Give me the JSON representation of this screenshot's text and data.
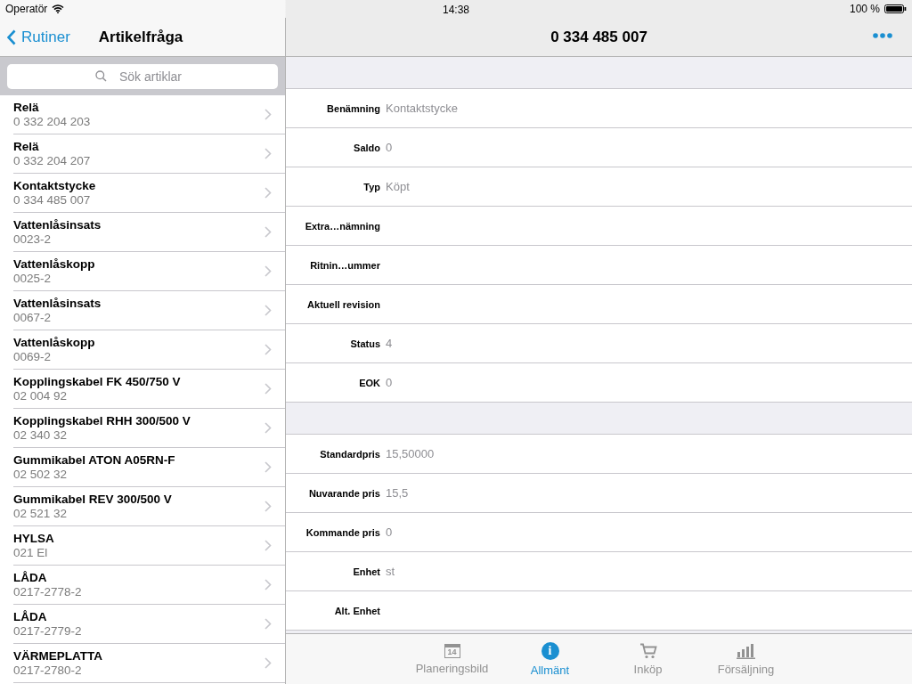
{
  "status_bar": {
    "carrier": "Operatör",
    "time": "14:38",
    "battery": "100 %"
  },
  "master": {
    "back": "Rutiner",
    "title": "Artikelfråga",
    "search": {
      "placeholder": "Sök artiklar"
    },
    "items": [
      {
        "name": "Relä",
        "number": "0 332 204 203"
      },
      {
        "name": "Relä",
        "number": "0 332 204 207"
      },
      {
        "name": "Kontaktstycke",
        "number": "0 334 485 007"
      },
      {
        "name": "Vattenlåsinsats",
        "number": "0023-2"
      },
      {
        "name": "Vattenlåskopp",
        "number": "0025-2"
      },
      {
        "name": "Vattenlåsinsats",
        "number": "0067-2"
      },
      {
        "name": "Vattenlåskopp",
        "number": "0069-2"
      },
      {
        "name": "Kopplingskabel FK 450/750 V",
        "number": "02 004 92"
      },
      {
        "name": "Kopplingskabel RHH 300/500 V",
        "number": "02 340 32"
      },
      {
        "name": "Gummikabel ATON A05RN-F",
        "number": "02 502 32"
      },
      {
        "name": "Gummikabel REV 300/500 V",
        "number": "02 521 32"
      },
      {
        "name": "HYLSA",
        "number": "021 El"
      },
      {
        "name": "LÅDA",
        "number": "0217-2778-2"
      },
      {
        "name": "LÅDA",
        "number": "0217-2779-2"
      },
      {
        "name": "VÄRMEPLATTA",
        "number": "0217-2780-2"
      }
    ]
  },
  "detail": {
    "title": "0 334 485 007",
    "sections": [
      [
        {
          "label": "Benämning",
          "value": "Kontaktstycke"
        },
        {
          "label": "Saldo",
          "value": "0"
        },
        {
          "label": "Typ",
          "value": "Köpt"
        },
        {
          "label": "Extra…nämning"
        },
        {
          "label": "Ritnin…ummer"
        },
        {
          "label": "Aktuell revision"
        },
        {
          "label": "Status",
          "value": "4"
        },
        {
          "label": "EOK",
          "value": "0"
        }
      ],
      [
        {
          "label": "Standardpris",
          "value": "15,50000"
        },
        {
          "label": "Nuvarande pris",
          "value": "15,5"
        },
        {
          "label": "Kommande pris",
          "value": "0"
        },
        {
          "label": "Enhet",
          "value": "st"
        },
        {
          "label": "Alt. Enhet"
        }
      ]
    ]
  },
  "tab_bar": [
    {
      "kind": "calendar",
      "label": "Planeringsbild",
      "icon_text": "14",
      "selected": false
    },
    {
      "kind": "info",
      "label": "Allmänt",
      "icon_text": "i",
      "selected": true
    },
    {
      "kind": "cart",
      "label": "Inköp",
      "selected": false
    },
    {
      "kind": "chart",
      "label": "Försäljning",
      "selected": false
    }
  ]
}
